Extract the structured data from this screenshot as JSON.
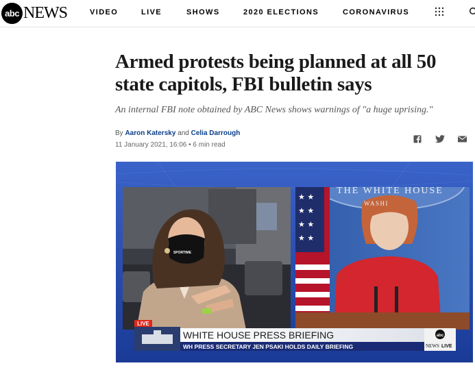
{
  "header": {
    "logo_abc": "abc",
    "logo_news": "NEWS",
    "nav": [
      "VIDEO",
      "LIVE",
      "SHOWS",
      "2020 ELECTIONS",
      "CORONAVIRUS"
    ]
  },
  "article": {
    "headline": "Armed protests being planned at all 50 state capitols, FBI bulletin says",
    "subhead": "An internal FBI note obtained by ABC News shows warnings of \"a huge uprising.\"",
    "byline_prefix": "By",
    "author_1": "Aaron Katersky",
    "byline_and": "and",
    "author_2": "Celia Darrough",
    "date": "11 January 2021, 16:06",
    "read_time": "6 min read"
  },
  "share": {
    "icons": [
      "facebook-icon",
      "twitter-icon",
      "email-icon"
    ]
  },
  "hero": {
    "wall_text_1": "THE WHITE HOUSE",
    "wall_text_2": "WASHI",
    "mask_text": "SPORTIME",
    "live_badge": "LIVE",
    "chyron_title": "WHITE HOUSE PRESS BRIEFING",
    "chyron_sub": "WH PRESS SECRETARY JEN PSAKI HOLDS DAILY BRIEFING",
    "bug_abc": "abc",
    "bug_news": "NEWS",
    "bug_live": "LIVE"
  },
  "colors": {
    "byline_link": "#0b3e8a",
    "hero_frame": "#2244a8",
    "live_red": "#e0261c"
  }
}
